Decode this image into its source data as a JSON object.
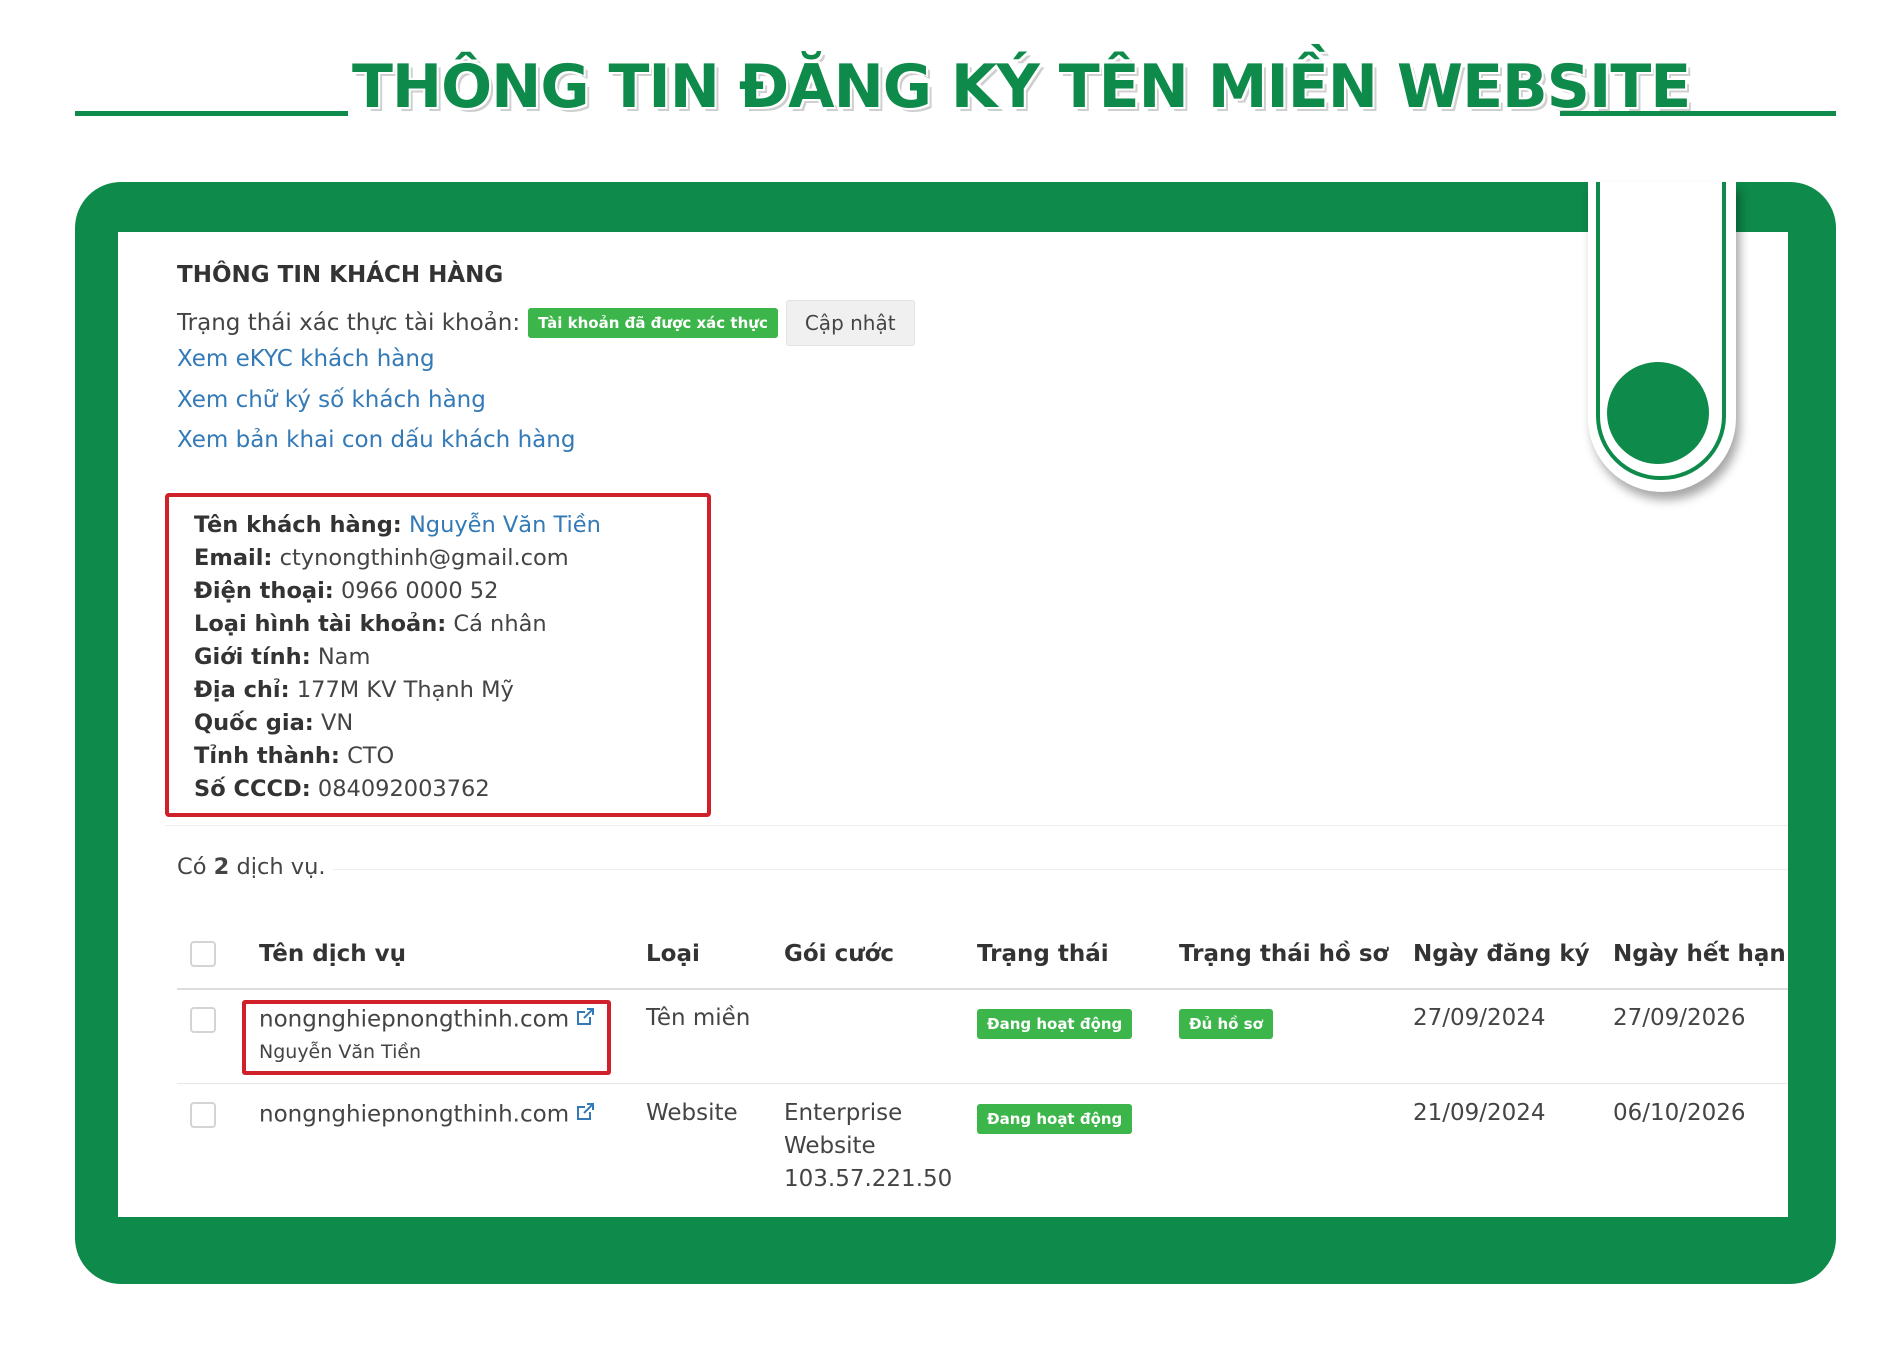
{
  "header": {
    "title": "THÔNG TIN ĐĂNG KÝ TÊN MIỀN WEBSITE"
  },
  "customer": {
    "section_title": "THÔNG TIN KHÁCH HÀNG",
    "verify_label": "Trạng thái xác thực tài khoản:",
    "verify_badge": "Tài khoản đã được xác thực",
    "update_button": "Cập nhật",
    "links": [
      "Xem eKYC khách hàng",
      "Xem chữ ký số khách hàng",
      "Xem bản khai con dấu khách hàng"
    ],
    "fields": [
      {
        "label": "Tên khách hàng:",
        "value": "Nguyễn Văn Tiền"
      },
      {
        "label": "Email:",
        "value": "ctynongthinh@gmail.com"
      },
      {
        "label": "Điện thoại:",
        "value": "0966 0000 52"
      },
      {
        "label": "Loại hình tài khoản:",
        "value": "Cá nhân"
      },
      {
        "label": "Giới tính:",
        "value": "Nam"
      },
      {
        "label": "Địa chỉ:",
        "value": "177M KV Thạnh Mỹ"
      },
      {
        "label": "Quốc gia:",
        "value": "VN"
      },
      {
        "label": "Tỉnh thành:",
        "value": "CTO"
      },
      {
        "label": "Số CCCD:",
        "value": "084092003762"
      }
    ]
  },
  "services": {
    "count_prefix": "Có",
    "count": "2",
    "count_suffix": "dịch vụ.",
    "columns": [
      "Tên dịch vụ",
      "Loại",
      "Gói cước",
      "Trạng thái",
      "Trạng thái hồ sơ",
      "Ngày đăng ký",
      "Ngày hết hạn"
    ],
    "rows": [
      {
        "name": "nongnghiepnongthinh.com",
        "owner": "Nguyễn Văn Tiền",
        "type": "Tên miền",
        "plan": [],
        "status": "Đang hoạt động",
        "profile_status": "Đủ hồ sơ",
        "registered": "27/09/2024",
        "expires": "27/09/2026"
      },
      {
        "name": "nongnghiepnongthinh.com",
        "owner": "",
        "type": "Website",
        "plan": [
          "Enterprise",
          "Website",
          "103.57.221.50"
        ],
        "status": "Đang hoạt động",
        "profile_status": "",
        "registered": "21/09/2024",
        "expires": "06/10/2026"
      }
    ]
  },
  "colors": {
    "brand_green": "#0e8a4a",
    "badge_green": "#3cb54a",
    "link_blue": "#337ab7",
    "highlight_red": "#d0202a"
  },
  "icons": [
    "external-link-icon",
    "bookmark-decoration"
  ]
}
